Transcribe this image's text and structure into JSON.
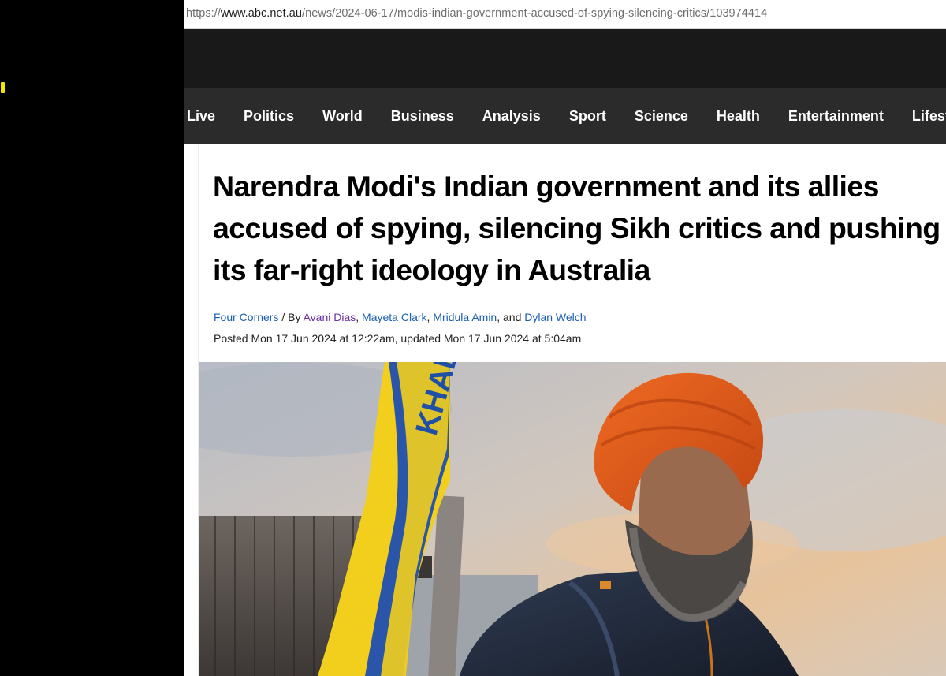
{
  "browser": {
    "url_scheme": "https://",
    "url_host": "www.abc.net.au",
    "url_path": "/news/2024-06-17/modis-indian-government-accused-of-spying-silencing-critics/103974414"
  },
  "nav": {
    "items": [
      "Live",
      "Politics",
      "World",
      "Business",
      "Analysis",
      "Sport",
      "Science",
      "Health",
      "Entertainment",
      "Lifestyle"
    ]
  },
  "article": {
    "headline": "Narendra Modi's Indian government and its allies accused of spying, silencing Sikh critics and pushing its far-right ideology in Australia",
    "program": "Four Corners",
    "by_sep": " / By ",
    "authors": [
      "Avani Dias",
      "Mayeta Clark",
      "Mridula Amin",
      "Dylan Welch"
    ],
    "sep_comma": ", ",
    "sep_and": ", and ",
    "posted": "Posted Mon 17 Jun 2024 at 12:22am, updated Mon 17 Jun 2024 at 5:04am"
  },
  "hero": {
    "flag_text": "KHALISTAN"
  },
  "colors": {
    "link": "#1a5fb4",
    "link_visited": "#6b2fa0",
    "nav_bg": "#2b2b2b",
    "topbar_bg": "#191919",
    "turban": "#e0591c",
    "flag": "#f2cf1d"
  }
}
